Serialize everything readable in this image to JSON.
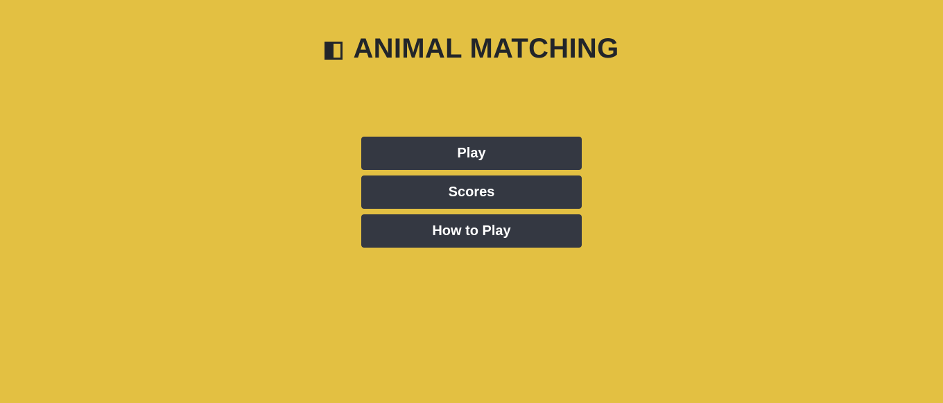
{
  "header": {
    "icon": "half-filled-square-icon",
    "title": "ANIMAL MATCHING"
  },
  "menu": {
    "play_label": "Play",
    "scores_label": "Scores",
    "how_to_play_label": "How to Play"
  },
  "colors": {
    "background": "#e3c042",
    "button": "#343842",
    "button_text": "#ffffff",
    "title_text": "#22252a"
  }
}
